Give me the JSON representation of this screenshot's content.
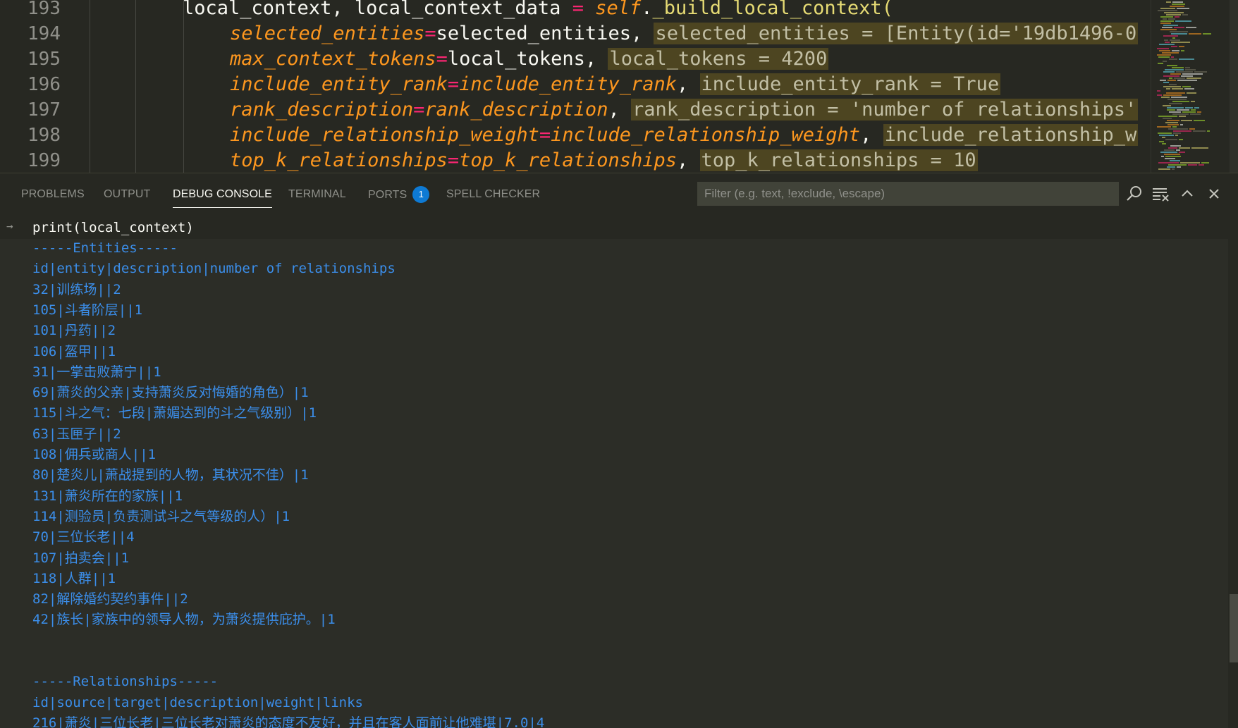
{
  "editor": {
    "lines": [
      {
        "number": "193",
        "segments": [
          {
            "text": "local_context, local_context_data ",
            "cls": "p-var"
          },
          {
            "text": "=",
            "cls": "p-op"
          },
          {
            "text": " ",
            "cls": "p-var"
          },
          {
            "text": "self",
            "cls": "p-self"
          },
          {
            "text": ".",
            "cls": "p-var"
          },
          {
            "text": "_build_local_context(",
            "cls": "p-fn"
          }
        ]
      },
      {
        "number": "194",
        "segments": [
          {
            "text": "selected_entities",
            "cls": "p-kw"
          },
          {
            "text": "=",
            "cls": "p-op"
          },
          {
            "text": "selected_entities",
            "cls": "p-var"
          },
          {
            "text": ", ",
            "cls": "p-var"
          },
          {
            "text": "selected_entities = [Entity(id='19db1496-0",
            "cls": "p-hint"
          }
        ]
      },
      {
        "number": "195",
        "segments": [
          {
            "text": "max_context_tokens",
            "cls": "p-kw"
          },
          {
            "text": "=",
            "cls": "p-op"
          },
          {
            "text": "local_tokens",
            "cls": "p-var"
          },
          {
            "text": ", ",
            "cls": "p-var"
          },
          {
            "text": "local_tokens = 4200",
            "cls": "p-hint"
          }
        ]
      },
      {
        "number": "196",
        "segments": [
          {
            "text": "include_entity_rank",
            "cls": "p-kw"
          },
          {
            "text": "=",
            "cls": "p-op"
          },
          {
            "text": "include_entity_rank",
            "cls": "p-kw"
          },
          {
            "text": ", ",
            "cls": "p-var"
          },
          {
            "text": "include_entity_rank = True",
            "cls": "p-hint"
          }
        ]
      },
      {
        "number": "197",
        "segments": [
          {
            "text": "rank_description",
            "cls": "p-kw"
          },
          {
            "text": "=",
            "cls": "p-op"
          },
          {
            "text": "rank_description",
            "cls": "p-kw"
          },
          {
            "text": ", ",
            "cls": "p-var"
          },
          {
            "text": "rank_description = 'number of relationships'",
            "cls": "p-hint"
          }
        ]
      },
      {
        "number": "198",
        "segments": [
          {
            "text": "include_relationship_weight",
            "cls": "p-kw"
          },
          {
            "text": "=",
            "cls": "p-op"
          },
          {
            "text": "include_relationship_weight",
            "cls": "p-kw"
          },
          {
            "text": ", ",
            "cls": "p-var"
          },
          {
            "text": "include_relationship_w",
            "cls": "p-hint"
          }
        ]
      },
      {
        "number": "199",
        "segments": [
          {
            "text": "top_k_relationships",
            "cls": "p-kw"
          },
          {
            "text": "=",
            "cls": "p-op"
          },
          {
            "text": "top_k_relationships",
            "cls": "p-kw"
          },
          {
            "text": ", ",
            "cls": "p-var"
          },
          {
            "text": "top_k_relationships = 10",
            "cls": "p-hint"
          }
        ]
      }
    ]
  },
  "panel": {
    "tabs": [
      {
        "label": "PROBLEMS",
        "active": false
      },
      {
        "label": "OUTPUT",
        "active": false
      },
      {
        "label": "DEBUG CONSOLE",
        "active": true
      },
      {
        "label": "TERMINAL",
        "active": false
      },
      {
        "label": "PORTS",
        "active": false,
        "badge": "1"
      },
      {
        "label": "SPELL CHECKER",
        "active": false
      }
    ],
    "filter_placeholder": "Filter (e.g. text, !exclude, \\escape)",
    "icons": [
      "search-icon",
      "clear-console-icon",
      "maximize-panel-icon",
      "close-panel-icon"
    ]
  },
  "console": {
    "input": "print(local_context)",
    "output": [
      "-----Entities-----",
      "id|entity|description|number of relationships",
      "32|训练场||2",
      "105|斗者阶层||1",
      "101|丹药||2",
      "106|盔甲||1",
      "31|一掌击败萧宁||1",
      "69|萧炎的父亲|支持萧炎反对悔婚的角色）|1",
      "115|斗之气：七段|萧媚达到的斗之气级别）|1",
      "63|玉匣子||2",
      "108|佣兵或商人||1",
      "80|楚炎儿|萧战提到的人物，其状况不佳）|1",
      "131|萧炎所在的家族||1",
      "114|测验员|负责测试斗之气等级的人）|1",
      "70|三位长老||4",
      "107|拍卖会||1",
      "118|人群||1",
      "82|解除婚约契约事件||2",
      "42|族长|家族中的领导人物，为萧炎提供庇护。|1",
      "",
      "",
      "-----Relationships-----",
      "id|source|target|description|weight|links",
      "216|萧炎|三位长老|三位长老对萧炎的态度不友好，并且在客人面前让他难堪|7.0|4"
    ]
  },
  "colors": {
    "background": "#272822",
    "output_text": "#3b8eea",
    "keyword_arg": "#fd971f",
    "operator": "#f92672",
    "badge": "#0e7ad4"
  }
}
